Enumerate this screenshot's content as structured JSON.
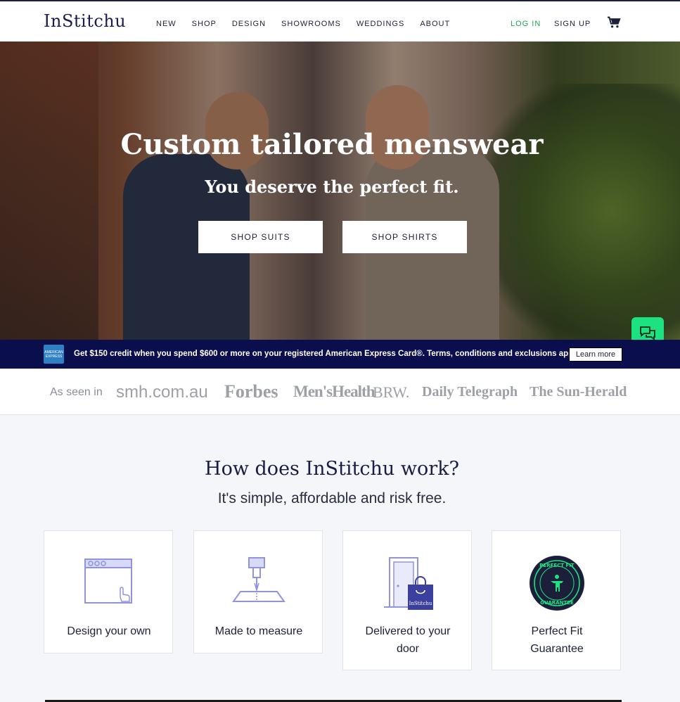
{
  "header": {
    "logo": "InStitchu",
    "nav": [
      "NEW",
      "SHOP",
      "DESIGN",
      "SHOWROOMS",
      "WEDDINGS",
      "ABOUT"
    ],
    "login": "LOG IN",
    "signup": "SIGN UP",
    "cart_icon": "cart-icon"
  },
  "hero": {
    "title": "Custom tailored menswear",
    "subtitle": "You deserve the perfect fit.",
    "buttons": [
      "SHOP SUITS",
      "SHOP SHIRTS"
    ],
    "chat_icon": "chat-icon"
  },
  "amex": {
    "logo_text": "AMERICAN EXPRESS",
    "text": "Get $150 credit when you spend $600 or more on your registered American Express Card®. Terms, conditions and exclusions apply.",
    "learn_more": "Learn more"
  },
  "press": {
    "label": "As seen in",
    "logos": [
      "smh.com.au",
      "Forbes",
      "Men'sHealth",
      "BRW.",
      "Daily Telegraph",
      "The Sun-Herald"
    ]
  },
  "how": {
    "title": "How does InStitchu work?",
    "subtitle": "It's simple, affordable and risk free.",
    "cards": [
      {
        "label": "Design your own",
        "icon": "browser-click-icon"
      },
      {
        "label": "Made to measure",
        "icon": "sewing-needle-icon"
      },
      {
        "label": "Delivered to your door",
        "icon": "door-bag-icon"
      },
      {
        "label": "Perfect Fit Guarantee",
        "icon": "perfect-fit-badge-icon"
      }
    ],
    "badge_text": "PERFECT FIT · GUARANTEE",
    "bag_text": "InStitchu"
  },
  "colors": {
    "navy": "#0a0e4d",
    "accent_green": "#1aa653",
    "chat_green": "#1de282"
  }
}
